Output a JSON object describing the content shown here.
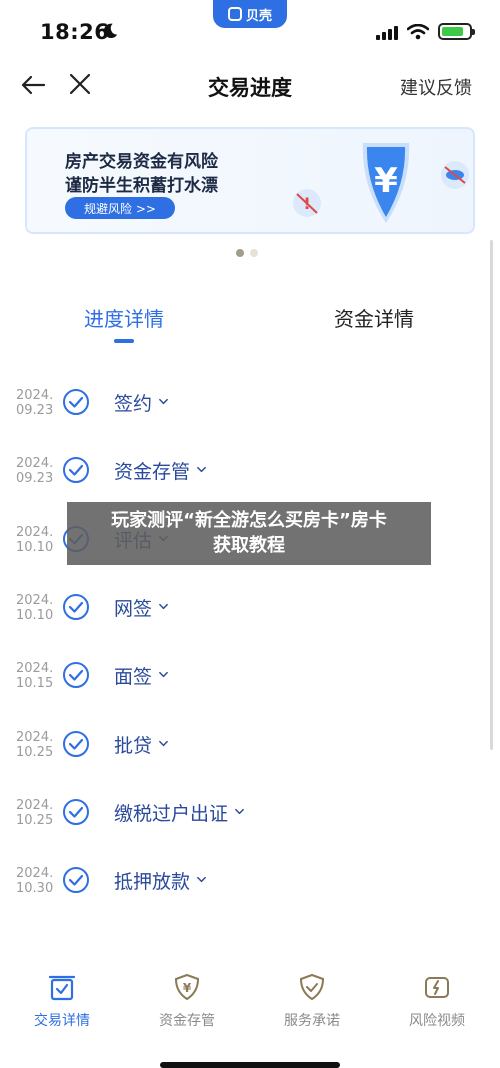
{
  "status_bar": {
    "time": "18:26",
    "app_pill": "贝壳"
  },
  "nav": {
    "title": "交易进度",
    "feedback": "建议反馈"
  },
  "banner": {
    "line1": "房产交易资金有风险",
    "line2": "谨防半生积蓄打水漂",
    "button": "规避风险 >>"
  },
  "tabs": {
    "progress": "进度详情",
    "funds": "资金详情"
  },
  "steps": [
    {
      "year": "2024.",
      "day": "09.23",
      "label": "签约"
    },
    {
      "year": "2024.",
      "day": "09.23",
      "label": "资金存管"
    },
    {
      "year": "2024.",
      "day": "10.10",
      "label": "评估"
    },
    {
      "year": "2024.",
      "day": "10.10",
      "label": "网签"
    },
    {
      "year": "2024.",
      "day": "10.15",
      "label": "面签"
    },
    {
      "year": "2024.",
      "day": "10.25",
      "label": "批贷"
    },
    {
      "year": "2024.",
      "day": "10.25",
      "label": "缴税过户出证"
    },
    {
      "year": "2024.",
      "day": "10.30",
      "label": "抵押放款"
    }
  ],
  "overlay": {
    "line1": "玩家测评“新全游怎么买房卡”房卡",
    "line2": "获取教程"
  },
  "bottom_nav": [
    {
      "label": "交易详情",
      "icon": "trade-detail-icon"
    },
    {
      "label": "资金存管",
      "icon": "funds-shield-icon"
    },
    {
      "label": "服务承诺",
      "icon": "service-shield-icon"
    },
    {
      "label": "风险视频",
      "icon": "risk-video-icon"
    }
  ],
  "colors": {
    "accent": "#2f6fe4",
    "step_text": "#2a4a9c",
    "date_text": "#9b9b9b"
  }
}
